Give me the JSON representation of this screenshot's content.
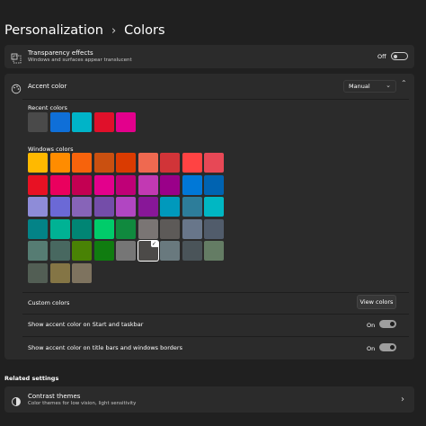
{
  "breadcrumb": {
    "parent": "Personalization",
    "separator": "›",
    "current": "Colors"
  },
  "transparency": {
    "title": "Transparency effects",
    "subtitle": "Windows and surfaces appear translucent",
    "state": "Off"
  },
  "accent": {
    "title": "Accent color",
    "mode": "Manual",
    "mode_chevron": "⌄",
    "collapse_chevron": "⌃"
  },
  "recent_colors": {
    "label": "Recent colors",
    "colors": [
      "#4a4a4a",
      "#0f6fd8",
      "#00b4c8",
      "#e0102a",
      "#e3008c"
    ]
  },
  "windows_colors": {
    "label": "Windows colors",
    "rows": [
      [
        "#ffb900",
        "#ff8c00",
        "#f7630c",
        "#ca5010",
        "#da3b01",
        "#ef6950",
        "#d13438",
        "#ff4343",
        "#e74856"
      ],
      [
        "#e81123",
        "#ea005e",
        "#c30052",
        "#e3008c",
        "#bf0077",
        "#c239b3",
        "#9a0089",
        "#0078d7",
        "#0063b1"
      ],
      [
        "#8e8cd8",
        "#6b69d6",
        "#8764b8",
        "#744da9",
        "#b146c2",
        "#881798",
        "#0099bc",
        "#2d7d9a",
        "#00b7c3"
      ],
      [
        "#038387",
        "#00b294",
        "#018574",
        "#00cc6a",
        "#10893e",
        "#7a7574",
        "#5d5a58",
        "#68768a",
        "#515c6b"
      ],
      [
        "#567c73",
        "#486860",
        "#498205",
        "#107c10",
        "#767676",
        "#4c4a48",
        "#69797e",
        "#4a5459",
        "#647c64"
      ],
      [
        "#525e54",
        "#847545",
        "#7e735f"
      ]
    ],
    "selected": "#4c4a48",
    "check_glyph": "✓"
  },
  "custom_colors": {
    "label": "Custom colors",
    "button": "View colors"
  },
  "start_taskbar": {
    "label": "Show accent color on Start and taskbar",
    "state": "On"
  },
  "title_bars": {
    "label": "Show accent color on title bars and windows borders",
    "state": "On"
  },
  "related": {
    "heading": "Related settings",
    "contrast_title": "Contrast themes",
    "contrast_subtitle": "Color themes for low vision, light sensitivity",
    "chevron": "›"
  },
  "colors": {
    "background": "#202020",
    "card": "#2b2b2b",
    "toggle_on": "#9e9e9e"
  }
}
